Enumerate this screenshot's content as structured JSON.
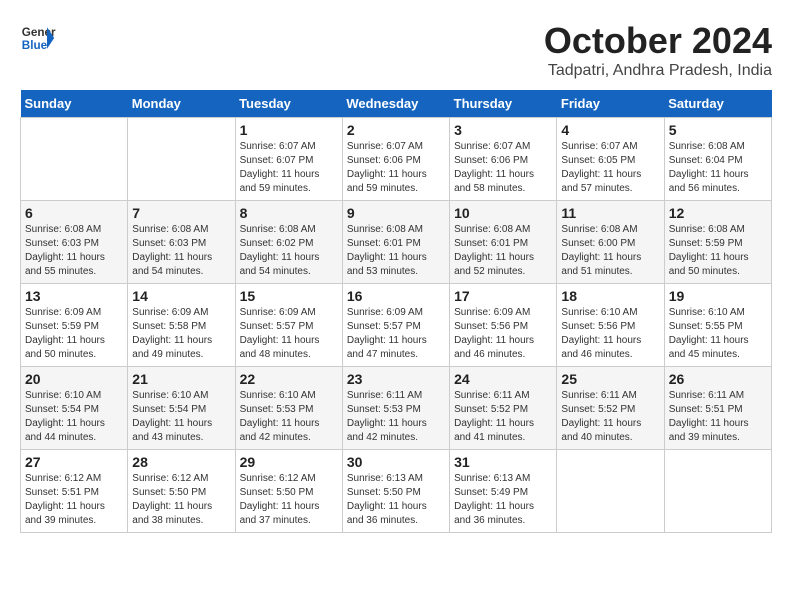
{
  "header": {
    "logo_line1": "General",
    "logo_line2": "Blue",
    "main_title": "October 2024",
    "sub_title": "Tadpatri, Andhra Pradesh, India"
  },
  "calendar": {
    "weekdays": [
      "Sunday",
      "Monday",
      "Tuesday",
      "Wednesday",
      "Thursday",
      "Friday",
      "Saturday"
    ],
    "weeks": [
      [
        {
          "day": "",
          "info": ""
        },
        {
          "day": "",
          "info": ""
        },
        {
          "day": "1",
          "info": "Sunrise: 6:07 AM\nSunset: 6:07 PM\nDaylight: 11 hours\nand 59 minutes."
        },
        {
          "day": "2",
          "info": "Sunrise: 6:07 AM\nSunset: 6:06 PM\nDaylight: 11 hours\nand 59 minutes."
        },
        {
          "day": "3",
          "info": "Sunrise: 6:07 AM\nSunset: 6:06 PM\nDaylight: 11 hours\nand 58 minutes."
        },
        {
          "day": "4",
          "info": "Sunrise: 6:07 AM\nSunset: 6:05 PM\nDaylight: 11 hours\nand 57 minutes."
        },
        {
          "day": "5",
          "info": "Sunrise: 6:08 AM\nSunset: 6:04 PM\nDaylight: 11 hours\nand 56 minutes."
        }
      ],
      [
        {
          "day": "6",
          "info": "Sunrise: 6:08 AM\nSunset: 6:03 PM\nDaylight: 11 hours\nand 55 minutes."
        },
        {
          "day": "7",
          "info": "Sunrise: 6:08 AM\nSunset: 6:03 PM\nDaylight: 11 hours\nand 54 minutes."
        },
        {
          "day": "8",
          "info": "Sunrise: 6:08 AM\nSunset: 6:02 PM\nDaylight: 11 hours\nand 54 minutes."
        },
        {
          "day": "9",
          "info": "Sunrise: 6:08 AM\nSunset: 6:01 PM\nDaylight: 11 hours\nand 53 minutes."
        },
        {
          "day": "10",
          "info": "Sunrise: 6:08 AM\nSunset: 6:01 PM\nDaylight: 11 hours\nand 52 minutes."
        },
        {
          "day": "11",
          "info": "Sunrise: 6:08 AM\nSunset: 6:00 PM\nDaylight: 11 hours\nand 51 minutes."
        },
        {
          "day": "12",
          "info": "Sunrise: 6:08 AM\nSunset: 5:59 PM\nDaylight: 11 hours\nand 50 minutes."
        }
      ],
      [
        {
          "day": "13",
          "info": "Sunrise: 6:09 AM\nSunset: 5:59 PM\nDaylight: 11 hours\nand 50 minutes."
        },
        {
          "day": "14",
          "info": "Sunrise: 6:09 AM\nSunset: 5:58 PM\nDaylight: 11 hours\nand 49 minutes."
        },
        {
          "day": "15",
          "info": "Sunrise: 6:09 AM\nSunset: 5:57 PM\nDaylight: 11 hours\nand 48 minutes."
        },
        {
          "day": "16",
          "info": "Sunrise: 6:09 AM\nSunset: 5:57 PM\nDaylight: 11 hours\nand 47 minutes."
        },
        {
          "day": "17",
          "info": "Sunrise: 6:09 AM\nSunset: 5:56 PM\nDaylight: 11 hours\nand 46 minutes."
        },
        {
          "day": "18",
          "info": "Sunrise: 6:10 AM\nSunset: 5:56 PM\nDaylight: 11 hours\nand 46 minutes."
        },
        {
          "day": "19",
          "info": "Sunrise: 6:10 AM\nSunset: 5:55 PM\nDaylight: 11 hours\nand 45 minutes."
        }
      ],
      [
        {
          "day": "20",
          "info": "Sunrise: 6:10 AM\nSunset: 5:54 PM\nDaylight: 11 hours\nand 44 minutes."
        },
        {
          "day": "21",
          "info": "Sunrise: 6:10 AM\nSunset: 5:54 PM\nDaylight: 11 hours\nand 43 minutes."
        },
        {
          "day": "22",
          "info": "Sunrise: 6:10 AM\nSunset: 5:53 PM\nDaylight: 11 hours\nand 42 minutes."
        },
        {
          "day": "23",
          "info": "Sunrise: 6:11 AM\nSunset: 5:53 PM\nDaylight: 11 hours\nand 42 minutes."
        },
        {
          "day": "24",
          "info": "Sunrise: 6:11 AM\nSunset: 5:52 PM\nDaylight: 11 hours\nand 41 minutes."
        },
        {
          "day": "25",
          "info": "Sunrise: 6:11 AM\nSunset: 5:52 PM\nDaylight: 11 hours\nand 40 minutes."
        },
        {
          "day": "26",
          "info": "Sunrise: 6:11 AM\nSunset: 5:51 PM\nDaylight: 11 hours\nand 39 minutes."
        }
      ],
      [
        {
          "day": "27",
          "info": "Sunrise: 6:12 AM\nSunset: 5:51 PM\nDaylight: 11 hours\nand 39 minutes."
        },
        {
          "day": "28",
          "info": "Sunrise: 6:12 AM\nSunset: 5:50 PM\nDaylight: 11 hours\nand 38 minutes."
        },
        {
          "day": "29",
          "info": "Sunrise: 6:12 AM\nSunset: 5:50 PM\nDaylight: 11 hours\nand 37 minutes."
        },
        {
          "day": "30",
          "info": "Sunrise: 6:13 AM\nSunset: 5:50 PM\nDaylight: 11 hours\nand 36 minutes."
        },
        {
          "day": "31",
          "info": "Sunrise: 6:13 AM\nSunset: 5:49 PM\nDaylight: 11 hours\nand 36 minutes."
        },
        {
          "day": "",
          "info": ""
        },
        {
          "day": "",
          "info": ""
        }
      ]
    ]
  }
}
